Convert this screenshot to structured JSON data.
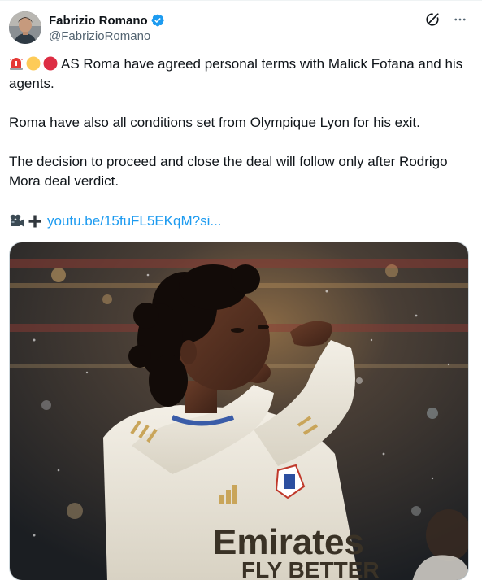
{
  "author": {
    "display_name": "Fabrizio Romano",
    "handle": "@FabrizioRomano",
    "verified": true,
    "avatar_icon": "avatar-photo"
  },
  "actions": {
    "grok_icon": "grok-icon",
    "more_icon": "more-dots-icon"
  },
  "tweet": {
    "lead_emojis": [
      "siren-emoji",
      "yellow-circle-emoji",
      "red-circle-emoji"
    ],
    "paragraph_1": "AS Roma have agreed personal terms with Malick Fofana and his agents.",
    "paragraph_2": "Roma have also all conditions set from Olympique Lyon for his exit.",
    "paragraph_3": "The decision to proceed and close the deal will follow only after Rodrigo Mora deal verdict.",
    "link_emojis": [
      "movie-camera-emoji",
      "plus-emoji"
    ],
    "link_text": "youtu.be/15fuFL5EKqM?si..."
  },
  "media": {
    "image_description_icon": "player-photo",
    "shirt_text": "Emirates FLY BETTER"
  },
  "colors": {
    "link": "#1d9bf0",
    "verified": "#1d9bf0",
    "text": "#0f1419",
    "secondary": "#536471"
  }
}
